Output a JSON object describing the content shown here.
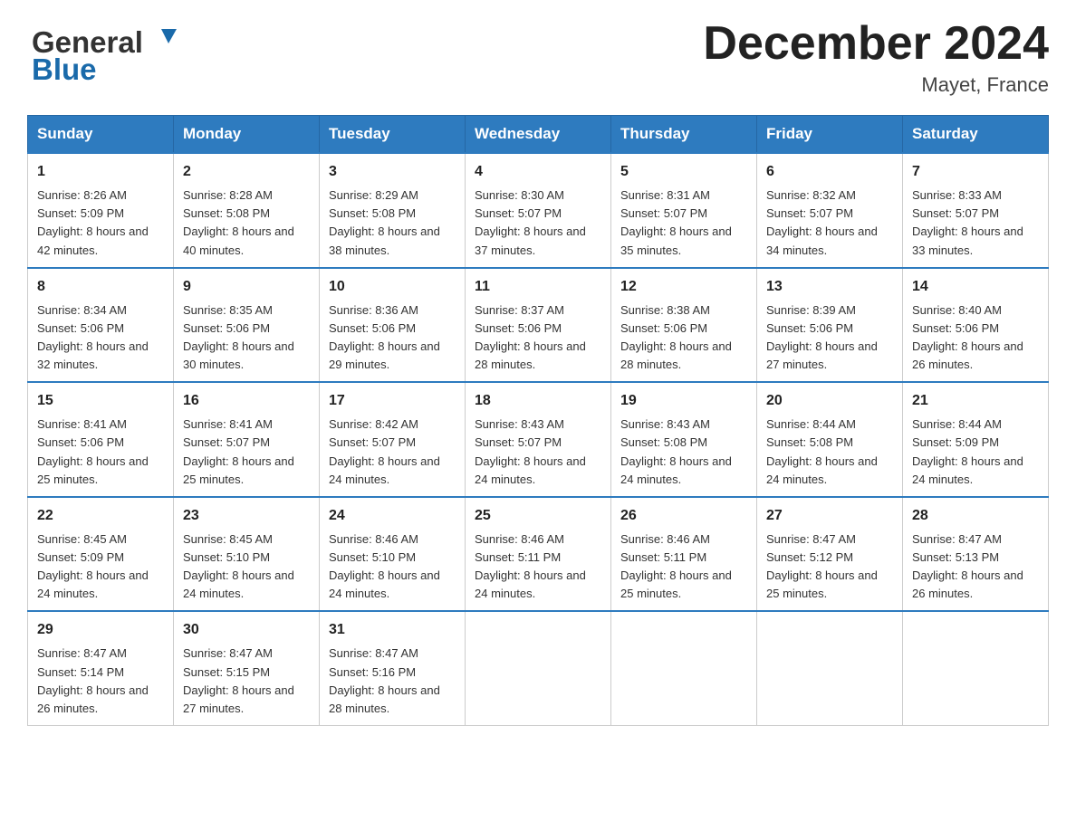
{
  "header": {
    "logo_general": "General",
    "logo_blue": "Blue",
    "main_title": "December 2024",
    "subtitle": "Mayet, France"
  },
  "calendar": {
    "days_of_week": [
      "Sunday",
      "Monday",
      "Tuesday",
      "Wednesday",
      "Thursday",
      "Friday",
      "Saturday"
    ],
    "weeks": [
      [
        {
          "day": "1",
          "sunrise": "Sunrise: 8:26 AM",
          "sunset": "Sunset: 5:09 PM",
          "daylight": "Daylight: 8 hours and 42 minutes."
        },
        {
          "day": "2",
          "sunrise": "Sunrise: 8:28 AM",
          "sunset": "Sunset: 5:08 PM",
          "daylight": "Daylight: 8 hours and 40 minutes."
        },
        {
          "day": "3",
          "sunrise": "Sunrise: 8:29 AM",
          "sunset": "Sunset: 5:08 PM",
          "daylight": "Daylight: 8 hours and 38 minutes."
        },
        {
          "day": "4",
          "sunrise": "Sunrise: 8:30 AM",
          "sunset": "Sunset: 5:07 PM",
          "daylight": "Daylight: 8 hours and 37 minutes."
        },
        {
          "day": "5",
          "sunrise": "Sunrise: 8:31 AM",
          "sunset": "Sunset: 5:07 PM",
          "daylight": "Daylight: 8 hours and 35 minutes."
        },
        {
          "day": "6",
          "sunrise": "Sunrise: 8:32 AM",
          "sunset": "Sunset: 5:07 PM",
          "daylight": "Daylight: 8 hours and 34 minutes."
        },
        {
          "day": "7",
          "sunrise": "Sunrise: 8:33 AM",
          "sunset": "Sunset: 5:07 PM",
          "daylight": "Daylight: 8 hours and 33 minutes."
        }
      ],
      [
        {
          "day": "8",
          "sunrise": "Sunrise: 8:34 AM",
          "sunset": "Sunset: 5:06 PM",
          "daylight": "Daylight: 8 hours and 32 minutes."
        },
        {
          "day": "9",
          "sunrise": "Sunrise: 8:35 AM",
          "sunset": "Sunset: 5:06 PM",
          "daylight": "Daylight: 8 hours and 30 minutes."
        },
        {
          "day": "10",
          "sunrise": "Sunrise: 8:36 AM",
          "sunset": "Sunset: 5:06 PM",
          "daylight": "Daylight: 8 hours and 29 minutes."
        },
        {
          "day": "11",
          "sunrise": "Sunrise: 8:37 AM",
          "sunset": "Sunset: 5:06 PM",
          "daylight": "Daylight: 8 hours and 28 minutes."
        },
        {
          "day": "12",
          "sunrise": "Sunrise: 8:38 AM",
          "sunset": "Sunset: 5:06 PM",
          "daylight": "Daylight: 8 hours and 28 minutes."
        },
        {
          "day": "13",
          "sunrise": "Sunrise: 8:39 AM",
          "sunset": "Sunset: 5:06 PM",
          "daylight": "Daylight: 8 hours and 27 minutes."
        },
        {
          "day": "14",
          "sunrise": "Sunrise: 8:40 AM",
          "sunset": "Sunset: 5:06 PM",
          "daylight": "Daylight: 8 hours and 26 minutes."
        }
      ],
      [
        {
          "day": "15",
          "sunrise": "Sunrise: 8:41 AM",
          "sunset": "Sunset: 5:06 PM",
          "daylight": "Daylight: 8 hours and 25 minutes."
        },
        {
          "day": "16",
          "sunrise": "Sunrise: 8:41 AM",
          "sunset": "Sunset: 5:07 PM",
          "daylight": "Daylight: 8 hours and 25 minutes."
        },
        {
          "day": "17",
          "sunrise": "Sunrise: 8:42 AM",
          "sunset": "Sunset: 5:07 PM",
          "daylight": "Daylight: 8 hours and 24 minutes."
        },
        {
          "day": "18",
          "sunrise": "Sunrise: 8:43 AM",
          "sunset": "Sunset: 5:07 PM",
          "daylight": "Daylight: 8 hours and 24 minutes."
        },
        {
          "day": "19",
          "sunrise": "Sunrise: 8:43 AM",
          "sunset": "Sunset: 5:08 PM",
          "daylight": "Daylight: 8 hours and 24 minutes."
        },
        {
          "day": "20",
          "sunrise": "Sunrise: 8:44 AM",
          "sunset": "Sunset: 5:08 PM",
          "daylight": "Daylight: 8 hours and 24 minutes."
        },
        {
          "day": "21",
          "sunrise": "Sunrise: 8:44 AM",
          "sunset": "Sunset: 5:09 PM",
          "daylight": "Daylight: 8 hours and 24 minutes."
        }
      ],
      [
        {
          "day": "22",
          "sunrise": "Sunrise: 8:45 AM",
          "sunset": "Sunset: 5:09 PM",
          "daylight": "Daylight: 8 hours and 24 minutes."
        },
        {
          "day": "23",
          "sunrise": "Sunrise: 8:45 AM",
          "sunset": "Sunset: 5:10 PM",
          "daylight": "Daylight: 8 hours and 24 minutes."
        },
        {
          "day": "24",
          "sunrise": "Sunrise: 8:46 AM",
          "sunset": "Sunset: 5:10 PM",
          "daylight": "Daylight: 8 hours and 24 minutes."
        },
        {
          "day": "25",
          "sunrise": "Sunrise: 8:46 AM",
          "sunset": "Sunset: 5:11 PM",
          "daylight": "Daylight: 8 hours and 24 minutes."
        },
        {
          "day": "26",
          "sunrise": "Sunrise: 8:46 AM",
          "sunset": "Sunset: 5:11 PM",
          "daylight": "Daylight: 8 hours and 25 minutes."
        },
        {
          "day": "27",
          "sunrise": "Sunrise: 8:47 AM",
          "sunset": "Sunset: 5:12 PM",
          "daylight": "Daylight: 8 hours and 25 minutes."
        },
        {
          "day": "28",
          "sunrise": "Sunrise: 8:47 AM",
          "sunset": "Sunset: 5:13 PM",
          "daylight": "Daylight: 8 hours and 26 minutes."
        }
      ],
      [
        {
          "day": "29",
          "sunrise": "Sunrise: 8:47 AM",
          "sunset": "Sunset: 5:14 PM",
          "daylight": "Daylight: 8 hours and 26 minutes."
        },
        {
          "day": "30",
          "sunrise": "Sunrise: 8:47 AM",
          "sunset": "Sunset: 5:15 PM",
          "daylight": "Daylight: 8 hours and 27 minutes."
        },
        {
          "day": "31",
          "sunrise": "Sunrise: 8:47 AM",
          "sunset": "Sunset: 5:16 PM",
          "daylight": "Daylight: 8 hours and 28 minutes."
        },
        null,
        null,
        null,
        null
      ]
    ]
  }
}
